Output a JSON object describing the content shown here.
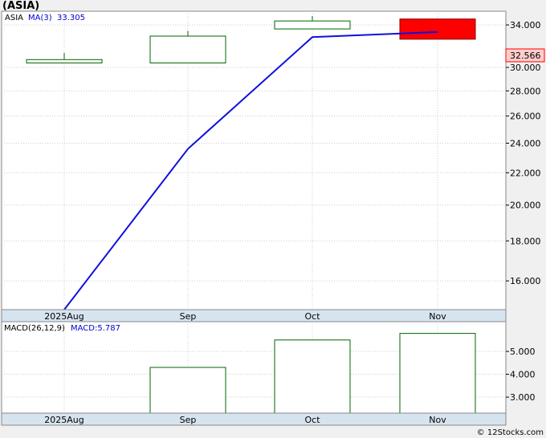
{
  "title": "(ASIA)",
  "legend": {
    "ticker": "ASIA",
    "ma_label": "MA(3)",
    "ma_value": "33.305",
    "ma_color": "#1010dd"
  },
  "last_price": "32.566",
  "copyright": "© 12Stocks.com",
  "colors": {
    "panel_bg": "#ffffff",
    "outer_bg": "#f0f0f0",
    "axis_band": "#d6e4f0",
    "up_candle": "#006400",
    "down_candle": "#ff0000",
    "macd_bar": "#006400",
    "ma_line": "#1010dd",
    "last_price_bg": "#ffcccc"
  },
  "chart_data": [
    {
      "type": "candlestick",
      "name": "price",
      "categories": [
        "2025Aug",
        "Sep",
        "Oct",
        "Nov"
      ],
      "candles": [
        {
          "open": 30.4,
          "close": 30.7,
          "high": 31.3,
          "low": 30.4
        },
        {
          "open": 30.4,
          "close": 32.9,
          "high": 33.4,
          "low": 30.4
        },
        {
          "open": 33.6,
          "close": 34.4,
          "high": 34.9,
          "low": 33.6
        },
        {
          "open": 34.6,
          "close": 32.6,
          "high": 34.6,
          "low": 32.6
        }
      ],
      "ma": {
        "name": "MA(3)",
        "values": [
          14.7,
          23.6,
          32.8,
          33.3
        ]
      },
      "ylim": [
        14.7,
        35.4
      ],
      "yscale": "log",
      "yticks": [
        16.0,
        18.0,
        20.0,
        22.0,
        24.0,
        26.0,
        28.0,
        30.0,
        34.0
      ],
      "ytick_labels": [
        "16.000",
        "18.000",
        "20.000",
        "22.000",
        "24.000",
        "26.000",
        "28.000",
        "30.000",
        "34.000"
      ],
      "grid": true
    },
    {
      "type": "bar",
      "name": "macd",
      "label": "MACD(26,12,9)",
      "value_label": "MACD:5.787",
      "categories": [
        "2025Aug",
        "Sep",
        "Oct",
        "Nov"
      ],
      "values": [
        null,
        4.3,
        5.5,
        5.787
      ],
      "ylim": [
        2.3,
        6.3
      ],
      "yticks": [
        3.0,
        4.0,
        5.0
      ],
      "ytick_labels": [
        "3.000",
        "4.000",
        "5.000"
      ],
      "grid": true
    }
  ]
}
